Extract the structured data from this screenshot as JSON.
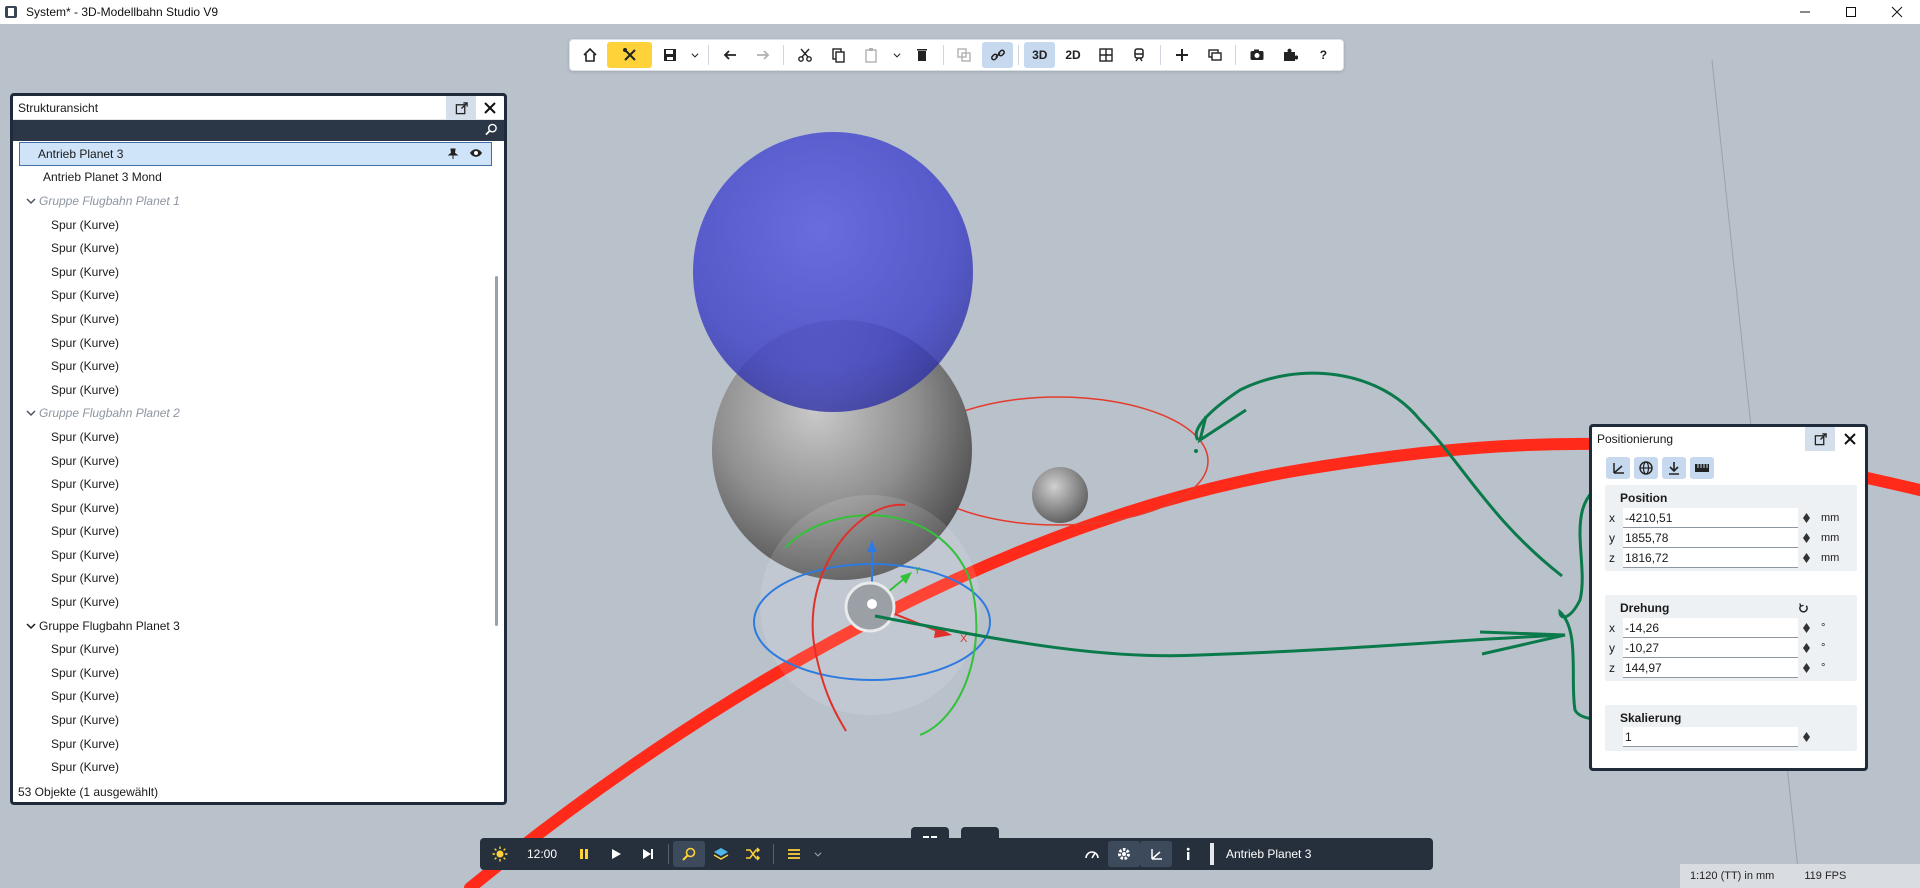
{
  "window": {
    "title": "System* - 3D-Modellbahn Studio V9"
  },
  "toolbar": {
    "view_3d_label": "3D",
    "view_2d_label": "2D",
    "help_label": "?"
  },
  "structure_panel": {
    "title": "Strukturansicht",
    "items": [
      {
        "label": "Antrieb Planet 3",
        "type": "item",
        "selected": true
      },
      {
        "label": "Antrieb Planet 3 Mond",
        "type": "item"
      },
      {
        "label": "Gruppe Flugbahn Planet 1",
        "type": "group"
      },
      {
        "label": "Spur (Kurve)",
        "type": "child"
      },
      {
        "label": "Spur (Kurve)",
        "type": "child"
      },
      {
        "label": "Spur (Kurve)",
        "type": "child"
      },
      {
        "label": "Spur (Kurve)",
        "type": "child"
      },
      {
        "label": "Spur (Kurve)",
        "type": "child"
      },
      {
        "label": "Spur (Kurve)",
        "type": "child"
      },
      {
        "label": "Spur (Kurve)",
        "type": "child"
      },
      {
        "label": "Spur (Kurve)",
        "type": "child"
      },
      {
        "label": "Gruppe Flugbahn Planet 2",
        "type": "group"
      },
      {
        "label": "Spur (Kurve)",
        "type": "child"
      },
      {
        "label": "Spur (Kurve)",
        "type": "child"
      },
      {
        "label": "Spur (Kurve)",
        "type": "child"
      },
      {
        "label": "Spur (Kurve)",
        "type": "child"
      },
      {
        "label": "Spur (Kurve)",
        "type": "child"
      },
      {
        "label": "Spur (Kurve)",
        "type": "child"
      },
      {
        "label": "Spur (Kurve)",
        "type": "child"
      },
      {
        "label": "Spur (Kurve)",
        "type": "child"
      },
      {
        "label": "Gruppe Flugbahn Planet 3",
        "type": "group-plain"
      },
      {
        "label": "Spur (Kurve)",
        "type": "child"
      },
      {
        "label": "Spur (Kurve)",
        "type": "child"
      },
      {
        "label": "Spur (Kurve)",
        "type": "child"
      },
      {
        "label": "Spur (Kurve)",
        "type": "child"
      },
      {
        "label": "Spur (Kurve)",
        "type": "child"
      },
      {
        "label": "Spur (Kurve)",
        "type": "child"
      }
    ],
    "status": "53 Objekte (1 ausgewählt)"
  },
  "positioning_panel": {
    "title": "Positionierung",
    "position": {
      "title": "Position",
      "x": {
        "label": "x",
        "value": "-4210,51",
        "unit": "mm"
      },
      "y": {
        "label": "y",
        "value": "1855,78",
        "unit": "mm"
      },
      "z": {
        "label": "z",
        "value": "1816,72",
        "unit": "mm"
      }
    },
    "rotation": {
      "title": "Drehung",
      "x": {
        "label": "x",
        "value": "-14,26",
        "unit": "°"
      },
      "y": {
        "label": "y",
        "value": "-10,27",
        "unit": "°"
      },
      "z": {
        "label": "z",
        "value": "144,97",
        "unit": "°"
      }
    },
    "scale": {
      "title": "Skalierung",
      "value": "1"
    }
  },
  "bottom_bar": {
    "time": "12:00",
    "selected_object": "Antrieb Planet 3"
  },
  "gizmo": {
    "x_label": "X",
    "y_label": "Y"
  },
  "status_bar": {
    "scale": "1:120 (TT) in mm",
    "fps": "119 FPS"
  },
  "colors": {
    "viewport": "#b9c1cb",
    "accent_yellow": "#ffd23a",
    "active_button": "#c7d9ef",
    "panel_border": "#1f2b3a",
    "track_red": "#ff2a1a",
    "annotation_green": "#0b7a4a"
  }
}
